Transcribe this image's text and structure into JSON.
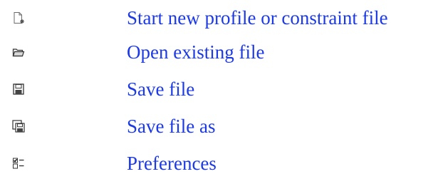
{
  "items": [
    {
      "label": "Start new profile or constraint file",
      "icon": "new-file-icon"
    },
    {
      "label": "Open existing file",
      "icon": "open-folder-icon"
    },
    {
      "label": "Save file",
      "icon": "save-disk-icon"
    },
    {
      "label": "Save file as",
      "icon": "save-as-disk-icon"
    },
    {
      "label": "Preferences",
      "icon": "preferences-checklist-icon"
    }
  ]
}
